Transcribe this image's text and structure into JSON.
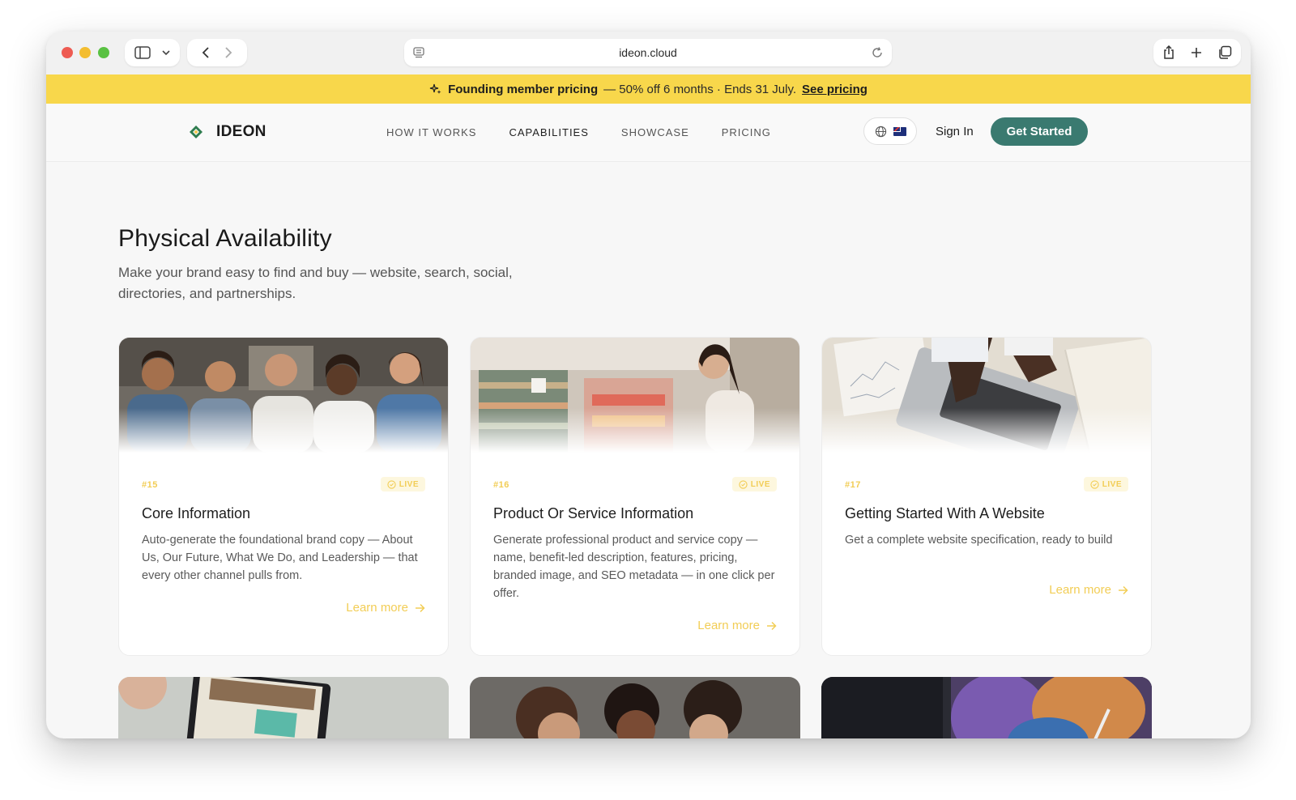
{
  "browser": {
    "url": "ideon.cloud"
  },
  "promo": {
    "strong": "Founding member pricing",
    "detail": "— 50% off 6 months · Ends 31 July.",
    "link": "See pricing"
  },
  "nav": {
    "brand": "IDEON",
    "links": [
      "HOW IT WORKS",
      "CAPABILITIES",
      "SHOWCASE",
      "PRICING"
    ],
    "active_link": "CAPABILITIES",
    "sign_in": "Sign In",
    "cta": "Get Started"
  },
  "section": {
    "title": "Physical Availability",
    "description": "Make your brand easy to find and buy — website, search, social, directories, and partnerships."
  },
  "cards": [
    {
      "number": "#15",
      "status": "LIVE",
      "title": "Core Information",
      "description": "Auto-generate the foundational brand copy — About Us, Our Future, What We Do, and Leadership — that every other channel pulls from.",
      "link": "Learn more"
    },
    {
      "number": "#16",
      "status": "LIVE",
      "title": "Product Or Service Information",
      "description": "Generate professional product and service copy — name, benefit-led description, features, pricing, branded image, and SEO metadata — in one click per offer.",
      "link": "Learn more"
    },
    {
      "number": "#17",
      "status": "LIVE",
      "title": "Getting Started With A Website",
      "description": "Get a complete website specification, ready to build",
      "link": "Learn more"
    }
  ],
  "colors": {
    "promo_bg": "#f8d74b",
    "cta_bg": "#3a7a70",
    "accent_yellow": "#f2cd55",
    "brand_green": "#2f7d4f"
  }
}
